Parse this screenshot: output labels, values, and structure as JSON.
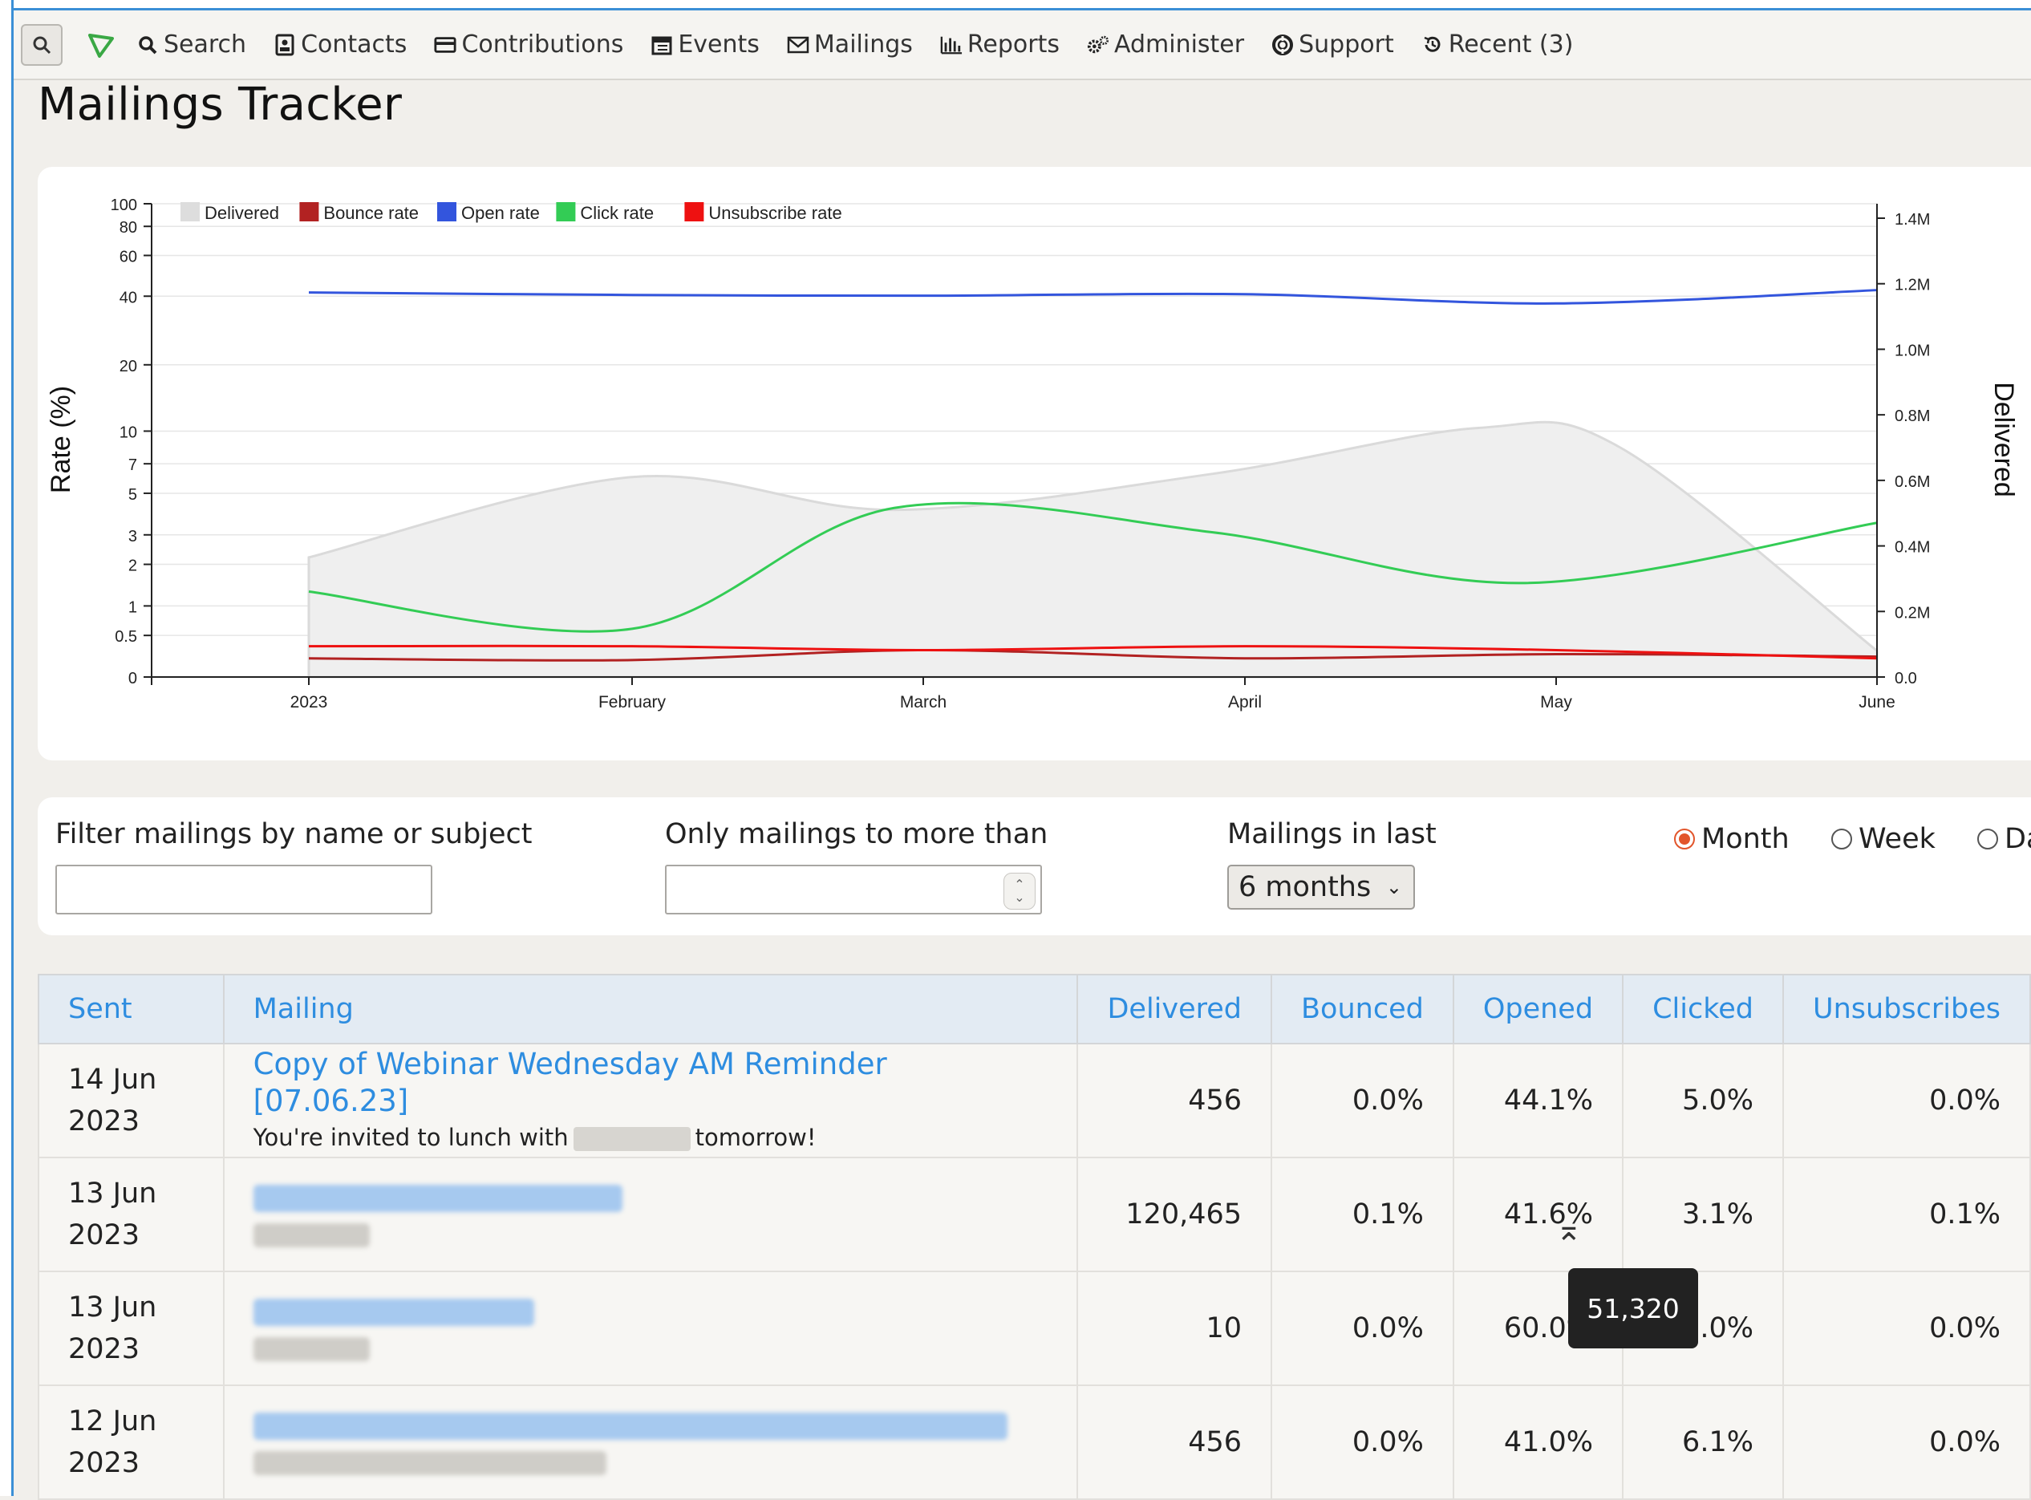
{
  "nav": {
    "items": [
      {
        "label": "Search",
        "icon": "search-icon"
      },
      {
        "label": "Contacts",
        "icon": "contact-card-icon"
      },
      {
        "label": "Contributions",
        "icon": "credit-card-icon"
      },
      {
        "label": "Events",
        "icon": "calendar-icon"
      },
      {
        "label": "Mailings",
        "icon": "envelope-icon"
      },
      {
        "label": "Reports",
        "icon": "bar-chart-icon"
      },
      {
        "label": "Administer",
        "icon": "gears-icon"
      },
      {
        "label": "Support",
        "icon": "lifebuoy-icon"
      },
      {
        "label": "Recent (3)",
        "icon": "history-icon"
      }
    ]
  },
  "page": {
    "title": "Mailings Tracker"
  },
  "chart_data": {
    "type": "line",
    "x": [
      "2023",
      "February",
      "March",
      "April",
      "May",
      "June"
    ],
    "ylabel": "Rate (%)",
    "y2label": "Delivered",
    "yticks": [
      "0",
      "0.5",
      "1",
      "2",
      "3",
      "5",
      "7",
      "10",
      "20",
      "40",
      "60",
      "80",
      "100"
    ],
    "y2ticks": [
      "0.0",
      "0.2M",
      "0.4M",
      "0.6M",
      "0.8M",
      "1.0M",
      "1.2M",
      "1.4M"
    ],
    "legend_position": "top-left",
    "series": [
      {
        "name": "Delivered",
        "type": "area",
        "color": "#dddddd",
        "axis": "right",
        "x": [
          0,
          1,
          1.9,
          2.9,
          3.75,
          4.2,
          5
        ],
        "values": [
          365000,
          610000,
          510000,
          620000,
          760000,
          700000,
          80000
        ]
      },
      {
        "name": "Bounce rate",
        "type": "line",
        "color": "#b22222",
        "x": [
          0,
          1,
          2,
          3,
          4,
          5
        ],
        "values": [
          0.2,
          0.18,
          0.3,
          0.2,
          0.25,
          0.22
        ]
      },
      {
        "name": "Open rate",
        "type": "line",
        "color": "#3355dd",
        "x": [
          0,
          1,
          2,
          3,
          4,
          5
        ],
        "values": [
          41.5,
          40.5,
          40.2,
          40.8,
          37.2,
          42.5
        ]
      },
      {
        "name": "Click rate",
        "type": "line",
        "color": "#33cc55",
        "x": [
          0,
          1,
          1.9,
          2.9,
          3.9,
          5
        ],
        "values": [
          1.3,
          0.6,
          4.2,
          3.1,
          1.5,
          3.5
        ]
      },
      {
        "name": "Unsubscribe rate",
        "type": "line",
        "color": "#ee1111",
        "x": [
          0,
          1,
          2,
          3,
          4,
          5
        ],
        "values": [
          0.35,
          0.35,
          0.3,
          0.35,
          0.3,
          0.2
        ]
      }
    ]
  },
  "filters": {
    "name_label": "Filter mailings by name or subject",
    "name_value": "",
    "min_label": "Only mailings to more than",
    "min_value": "",
    "period_label": "Mailings in last",
    "period_value": "6 months",
    "granularity": [
      {
        "label": "Month",
        "selected": true
      },
      {
        "label": "Week",
        "selected": false
      },
      {
        "label": "Day",
        "selected": false
      }
    ]
  },
  "table": {
    "headers": {
      "sent": "Sent",
      "mailing": "Mailing",
      "delivered": "Delivered",
      "bounced": "Bounced",
      "opened": "Opened",
      "clicked": "Clicked",
      "unsubscribes": "Unsubscribes"
    },
    "rows": [
      {
        "sent_day": "14 Jun",
        "sent_year": "2023",
        "name": "Copy of Webinar Wednesday AM Reminder [07.06.23]",
        "subject_start": "You're invited to lunch with",
        "subject_end": "tomorrow!",
        "delivered": "456",
        "bounced": "0.0%",
        "opened": "44.1%",
        "clicked": "5.0%",
        "unsubscribes": "0.0%"
      },
      {
        "sent_day": "13 Jun",
        "sent_year": "2023",
        "delivered": "120,465",
        "bounced": "0.1%",
        "opened": "41.6%",
        "clicked": "3.1%",
        "unsubscribes": "0.1%"
      },
      {
        "sent_day": "13 Jun",
        "sent_year": "2023",
        "delivered": "10",
        "bounced": "0.0%",
        "opened": "60.0%",
        "clicked": "30.0%",
        "unsubscribes": "0.0%"
      },
      {
        "sent_day": "12 Jun",
        "sent_year": "2023",
        "delivered": "456",
        "bounced": "0.0%",
        "opened": "41.0%",
        "clicked": "6.1%",
        "unsubscribes": "0.0%"
      }
    ]
  },
  "tooltip": {
    "text": "51,320"
  }
}
